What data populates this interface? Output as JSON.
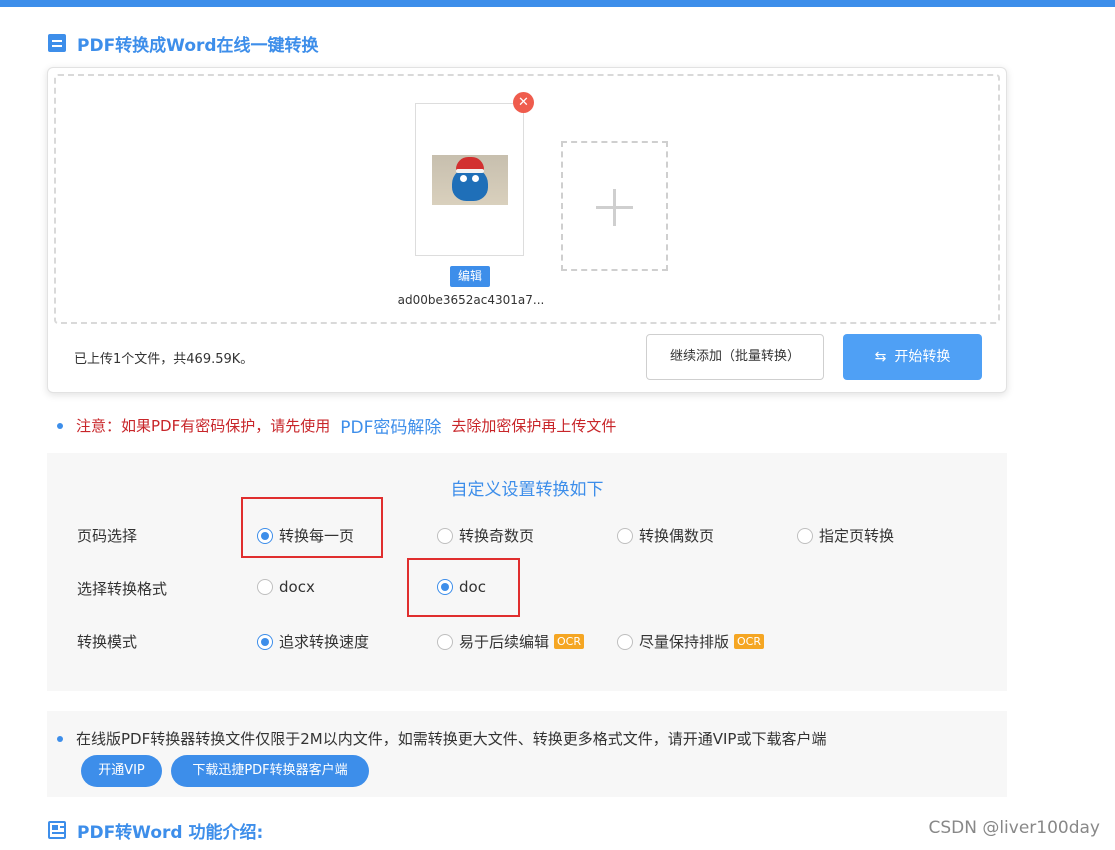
{
  "header": {
    "title": "PDF转换成Word在线一键转换"
  },
  "upload": {
    "file": {
      "name": "ad00be3652ac4301a7...",
      "edit_label": "编辑",
      "remove_symbol": "✕"
    },
    "status": "已上传1个文件，共469.59K。",
    "continue_label": "继续添加（批量转换）",
    "start_label": "开始转换"
  },
  "notice": {
    "prefix": "注意：如果PDF有密码保护，请先使用",
    "link": "PDF密码解除",
    "suffix": "去除加密保护再上传文件"
  },
  "settings": {
    "title": "自定义设置转换如下",
    "page_select": {
      "label": "页码选择",
      "options": [
        "转换每一页",
        "转换奇数页",
        "转换偶数页",
        "指定页转换"
      ],
      "selected": "转换每一页"
    },
    "format": {
      "label": "选择转换格式",
      "options": [
        "docx",
        "doc"
      ],
      "selected": "doc"
    },
    "mode": {
      "label": "转换模式",
      "options": [
        "追求转换速度",
        "易于后续编辑",
        "尽量保持排版"
      ],
      "badge": "OCR",
      "selected": "追求转换速度"
    }
  },
  "info": {
    "text": "在线版PDF转换器转换文件仅限于2M以内文件，如需转换更大文件、转换更多格式文件，请开通VIP或下载客户端",
    "vip_label": "开通VIP",
    "download_label": "下载迅捷PDF转换器客户端"
  },
  "intro": {
    "title": "PDF转Word 功能介绍:"
  },
  "watermark": "CSDN @liver100day",
  "colors": {
    "accent": "#3d8eea",
    "warning": "#c8262a",
    "ocr": "#f5a623",
    "highlight": "#e02e2e"
  },
  "icons": [
    "document-icon",
    "close-icon",
    "plus-icon",
    "swap-icon",
    "intro-icon"
  ]
}
